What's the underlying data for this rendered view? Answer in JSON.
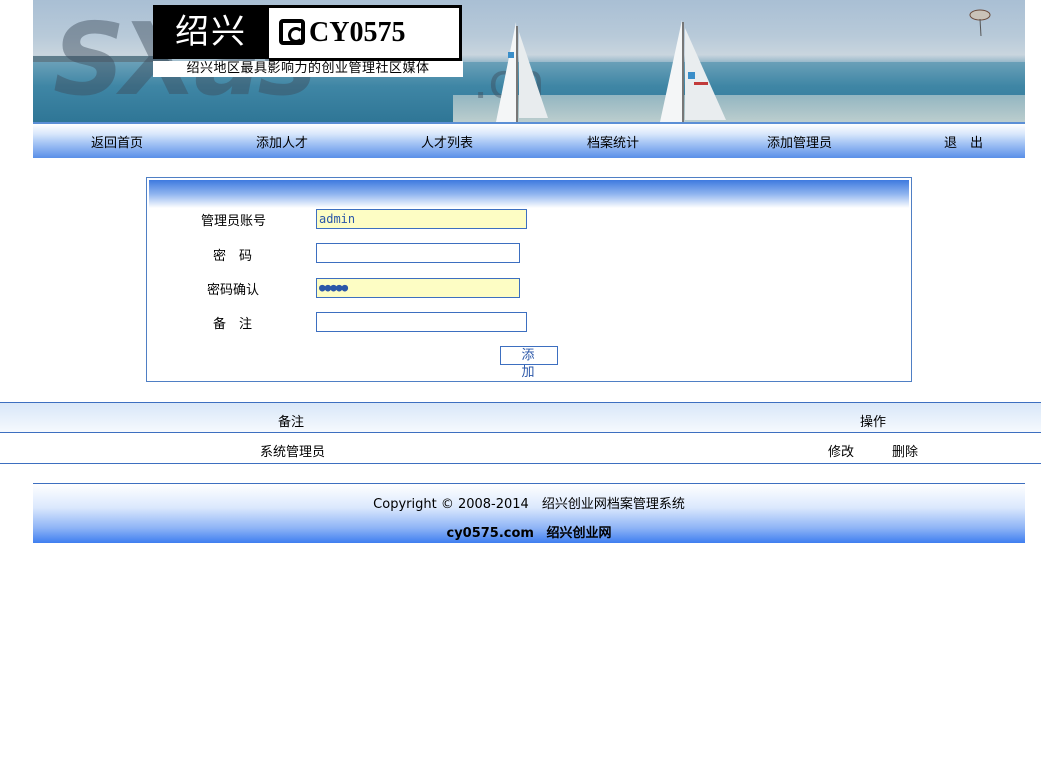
{
  "banner": {
    "watermark": "SXas",
    "watermark_domain": ".cn",
    "logo_cn": "绍兴",
    "logo_en": "CY0575",
    "logo_slogan": "绍兴地区最具影响力的创业管理社区媒体"
  },
  "nav": {
    "items": [
      "返回首页",
      "添加人才",
      "人才列表",
      "档案统计",
      "添加管理员",
      "退　出"
    ]
  },
  "form": {
    "account_label": "管理员账号",
    "account_value": "admin",
    "password_label": "密　码",
    "password_value": "",
    "confirm_label": "密码确认",
    "confirm_value": "●●●●●",
    "note_label": "备　注",
    "note_value": "",
    "submit_label": "添 加"
  },
  "table": {
    "headers": [
      "备注",
      "操作"
    ],
    "rows": [
      {
        "note": "系统管理员",
        "edit": "修改",
        "delete": "删除"
      }
    ]
  },
  "footer": {
    "copyright": "Copyright © 2008-2014　绍兴创业网档案管理系统",
    "domain": "cy0575.com",
    "site_name": "绍兴创业网"
  },
  "colors": {
    "border_blue": "#3d6fc0",
    "nav_gradient_bottom": "#5a8fe8",
    "input_fill": "#fdfdc4"
  }
}
